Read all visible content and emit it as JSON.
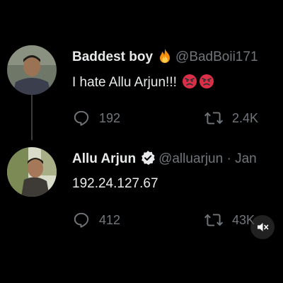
{
  "tweets": [
    {
      "name": "Baddest boy",
      "name_icon": "fire-icon",
      "handle": "@BadBoii171",
      "text": "I hate Allu Arjun!!!",
      "text_icons": [
        "angry-face-icon",
        "angry-face-icon"
      ],
      "replies": "192",
      "retweets": "2.4K"
    },
    {
      "name": "Allu Arjun",
      "name_icon": "verified-badge-icon",
      "handle": "@alluarjun · Jan",
      "text": "192.24.127.67",
      "replies": "412",
      "retweets": "43K"
    }
  ],
  "video_overlay": {
    "icon": "mute-icon"
  },
  "colors": {
    "background": "#000000",
    "text": "#e7e9ea",
    "secondary": "#71767b",
    "verified": "#e7e9ea"
  }
}
